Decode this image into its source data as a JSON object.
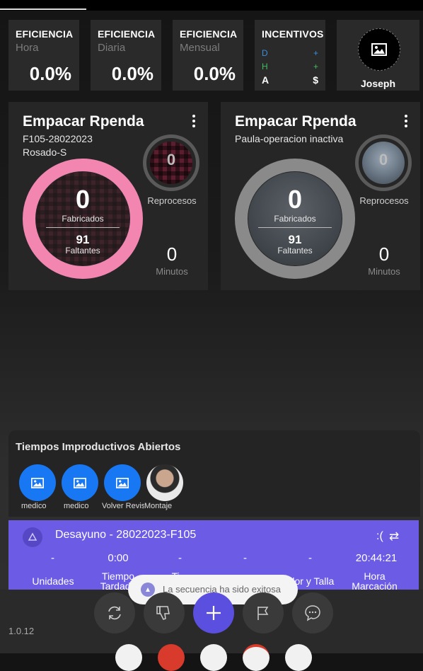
{
  "colors": {
    "accent": "#6b5be5",
    "pink_ring": "#f286b1",
    "gray_ring": "#8a8a8a",
    "blue": "#1877f2"
  },
  "stats": [
    {
      "title": "EFICIENCIA",
      "subtitle": "Hora",
      "value": "0.0%"
    },
    {
      "title": "EFICIENCIA",
      "subtitle": "Diaria",
      "value": "0.0%"
    },
    {
      "title": "EFICIENCIA",
      "subtitle": "Mensual",
      "value": "0.0%"
    }
  ],
  "incentivos": {
    "title": "INCENTIVOS",
    "rows": [
      {
        "left": "D",
        "right": "+",
        "color": "#3a8dde"
      },
      {
        "left": "H",
        "right": "+",
        "color": "#3fbf5f"
      },
      {
        "left": "A",
        "right": "$",
        "color": "#ffffff"
      }
    ]
  },
  "user": {
    "name": "Joseph",
    "icon": "image-placeholder-icon"
  },
  "cards": [
    {
      "title": "Empacar Rpenda",
      "line1": "F105-28022023",
      "line2": "Rosado-S",
      "fabricados": "0",
      "fabricados_label": "Fabricados",
      "faltantes": "91",
      "faltantes_label": "Faltantes",
      "reprocesos": "0",
      "reprocesos_label": "Reprocesos",
      "minutos": "0",
      "minutos_label": "Minutos"
    },
    {
      "title": "Empacar Rpenda",
      "line1": "Paula-operacion inactiva",
      "line2": "",
      "fabricados": "0",
      "fabricados_label": "Fabricados",
      "faltantes": "91",
      "faltantes_label": "Faltantes",
      "reprocesos": "0",
      "reprocesos_label": "Reprocesos",
      "minutos": "0",
      "minutos_label": "Minutos"
    }
  ],
  "tiempos": {
    "title": "Tiempos Improductivos Abiertos",
    "items": [
      {
        "label": "medico",
        "icon": "image-placeholder-icon"
      },
      {
        "label": "medico",
        "icon": "image-placeholder-icon"
      },
      {
        "label": "Volver Revisar",
        "icon": "image-placeholder-icon"
      },
      {
        "label": "Montaje",
        "icon": "person-photo"
      }
    ]
  },
  "banner": {
    "title": "Desayuno - 28022023-F105",
    "sad": ":(",
    "values": [
      "-",
      "0:00",
      "-",
      "-",
      "-",
      "20:44:21"
    ],
    "labels": [
      "Unidades",
      "Tiempo Tardado",
      "Ti...",
      "",
      "...lor y Talla",
      "Hora Marcación"
    ]
  },
  "toast": {
    "text": "La secuencia ha sido exitosa"
  },
  "version": "1.0.12",
  "actions": [
    "refresh-icon",
    "thumbs-down-icon",
    "plus-icon",
    "flag-icon",
    "chat-icon"
  ]
}
